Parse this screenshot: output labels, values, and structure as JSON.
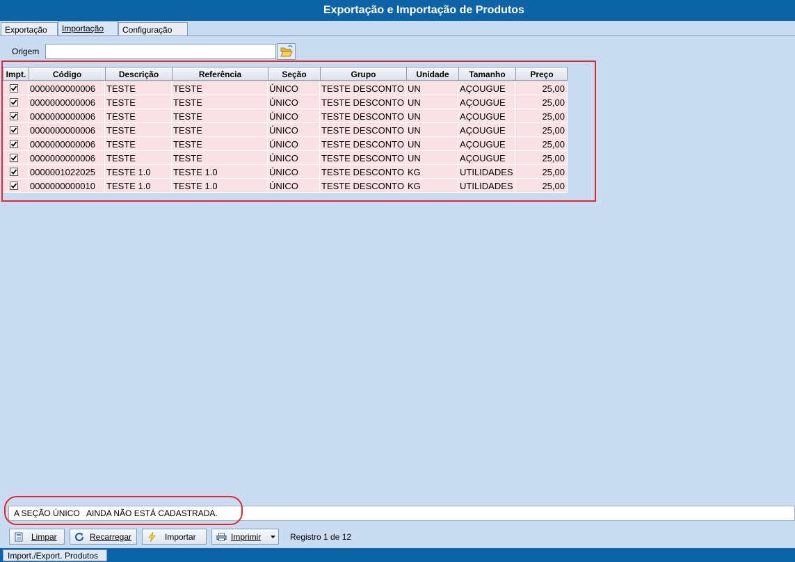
{
  "window": {
    "title": "Exportação e Importação de Produtos"
  },
  "tabs": [
    {
      "label": "Exportação"
    },
    {
      "label": "Importação"
    },
    {
      "label": "Configuração"
    }
  ],
  "origem": {
    "label": "Origem",
    "value": ""
  },
  "table": {
    "headers": [
      "Impt.",
      "Código",
      "Descrição",
      "Referência",
      "Seção",
      "Grupo",
      "Unidade",
      "Tamanho",
      "Preço"
    ],
    "rows": [
      {
        "codigo": "0000000000006",
        "descricao": "TESTE",
        "referencia": "TESTE",
        "secao": "ÚNICO",
        "grupo": "TESTE DESCONTO",
        "unidade": "UN",
        "tamanho": "AÇOUGUE",
        "preco": "25,00",
        "checked": true
      },
      {
        "codigo": "0000000000006",
        "descricao": "TESTE",
        "referencia": "TESTE",
        "secao": "ÚNICO",
        "grupo": "TESTE DESCONTO",
        "unidade": "UN",
        "tamanho": "AÇOUGUE",
        "preco": "25,00",
        "checked": true
      },
      {
        "codigo": "0000000000006",
        "descricao": "TESTE",
        "referencia": "TESTE",
        "secao": "ÚNICO",
        "grupo": "TESTE DESCONTO",
        "unidade": "UN",
        "tamanho": "AÇOUGUE",
        "preco": "25,00",
        "checked": true
      },
      {
        "codigo": "0000000000006",
        "descricao": "TESTE",
        "referencia": "TESTE",
        "secao": "ÚNICO",
        "grupo": "TESTE DESCONTO",
        "unidade": "UN",
        "tamanho": "AÇOUGUE",
        "preco": "25,00",
        "checked": true
      },
      {
        "codigo": "0000000000006",
        "descricao": "TESTE",
        "referencia": "TESTE",
        "secao": "ÚNICO",
        "grupo": "TESTE DESCONTO",
        "unidade": "UN",
        "tamanho": "AÇOUGUE",
        "preco": "25,00",
        "checked": true
      },
      {
        "codigo": "0000000000006",
        "descricao": "TESTE",
        "referencia": "TESTE",
        "secao": "ÚNICO",
        "grupo": "TESTE DESCONTO",
        "unidade": "UN",
        "tamanho": "AÇOUGUE",
        "preco": "25,00",
        "checked": true
      },
      {
        "codigo": "0000001022025",
        "descricao": "TESTE 1.0",
        "referencia": "TESTE 1.0",
        "secao": "ÚNICO",
        "grupo": "TESTE DESCONTO",
        "unidade": "KG",
        "tamanho": "UTILIDADES",
        "preco": "25,00",
        "checked": true
      },
      {
        "codigo": "0000000000010",
        "descricao": "TESTE 1.0",
        "referencia": "TESTE 1.0",
        "secao": "ÚNICO",
        "grupo": "TESTE DESCONTO",
        "unidade": "KG",
        "tamanho": "UTILIDADES",
        "preco": "25,00",
        "checked": true
      }
    ]
  },
  "message": {
    "text": "A SEÇÃO ÚNICO   AINDA NÃO ESTÁ CADASTRADA."
  },
  "buttons": {
    "limpar": "Limpar",
    "recarregar": "Recarregar",
    "importar": "Importar",
    "imprimir": "Imprimir"
  },
  "registro": "Registro 1 de 12",
  "status": {
    "panel": "Import./Export. Produtos"
  },
  "colors": {
    "titlebar": "#0c63a6",
    "background": "#c9dcf1",
    "row": "#f9e1e6",
    "highlight": "#e2262e"
  },
  "icons": {
    "folder": "folder-open-icon",
    "limpar": "eraser-icon",
    "recarregar": "reload-icon",
    "importar": "lightning-icon",
    "imprimir": "printer-icon"
  }
}
